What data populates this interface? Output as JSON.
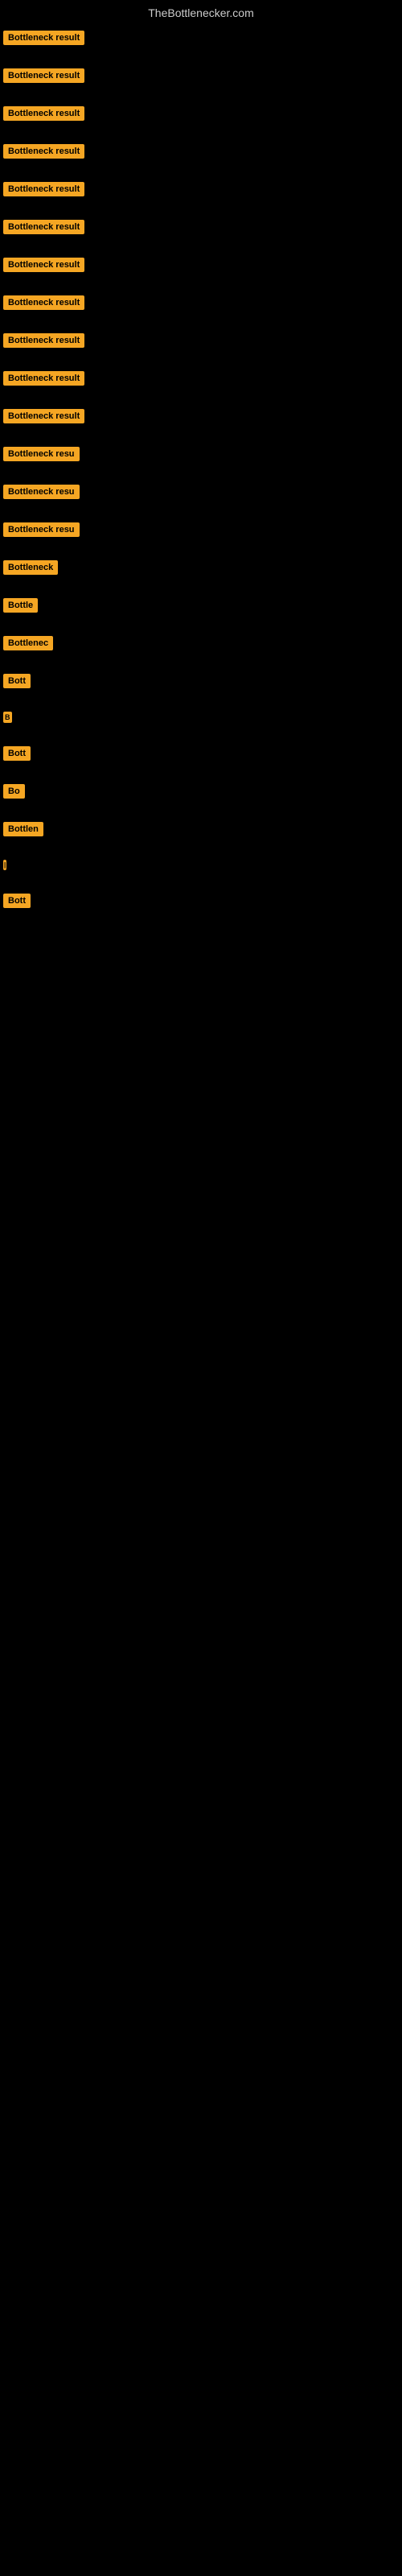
{
  "header": {
    "site_title": "TheBottlenecker.com"
  },
  "items": [
    {
      "label": "Bottleneck result",
      "index": 0
    },
    {
      "label": "Bottleneck result",
      "index": 1
    },
    {
      "label": "Bottleneck result",
      "index": 2
    },
    {
      "label": "Bottleneck result",
      "index": 3
    },
    {
      "label": "Bottleneck result",
      "index": 4
    },
    {
      "label": "Bottleneck result",
      "index": 5
    },
    {
      "label": "Bottleneck result",
      "index": 6
    },
    {
      "label": "Bottleneck result",
      "index": 7
    },
    {
      "label": "Bottleneck result",
      "index": 8
    },
    {
      "label": "Bottleneck result",
      "index": 9
    },
    {
      "label": "Bottleneck result",
      "index": 10
    },
    {
      "label": "Bottleneck resu",
      "index": 11
    },
    {
      "label": "Bottleneck resu",
      "index": 12
    },
    {
      "label": "Bottleneck resu",
      "index": 13
    },
    {
      "label": "Bottleneck",
      "index": 14
    },
    {
      "label": "Bottle",
      "index": 15
    },
    {
      "label": "Bottlenec",
      "index": 16
    },
    {
      "label": "Bott",
      "index": 17
    },
    {
      "label": "B",
      "index": 18
    },
    {
      "label": "Bott",
      "index": 19
    },
    {
      "label": "Bo",
      "index": 20
    },
    {
      "label": "Bottlen",
      "index": 21
    },
    {
      "label": "|",
      "index": 22
    },
    {
      "label": "Bott",
      "index": 23
    }
  ],
  "colors": {
    "badge_bg": "#f5a623",
    "badge_text": "#000000",
    "background": "#000000",
    "title_text": "#cccccc"
  }
}
